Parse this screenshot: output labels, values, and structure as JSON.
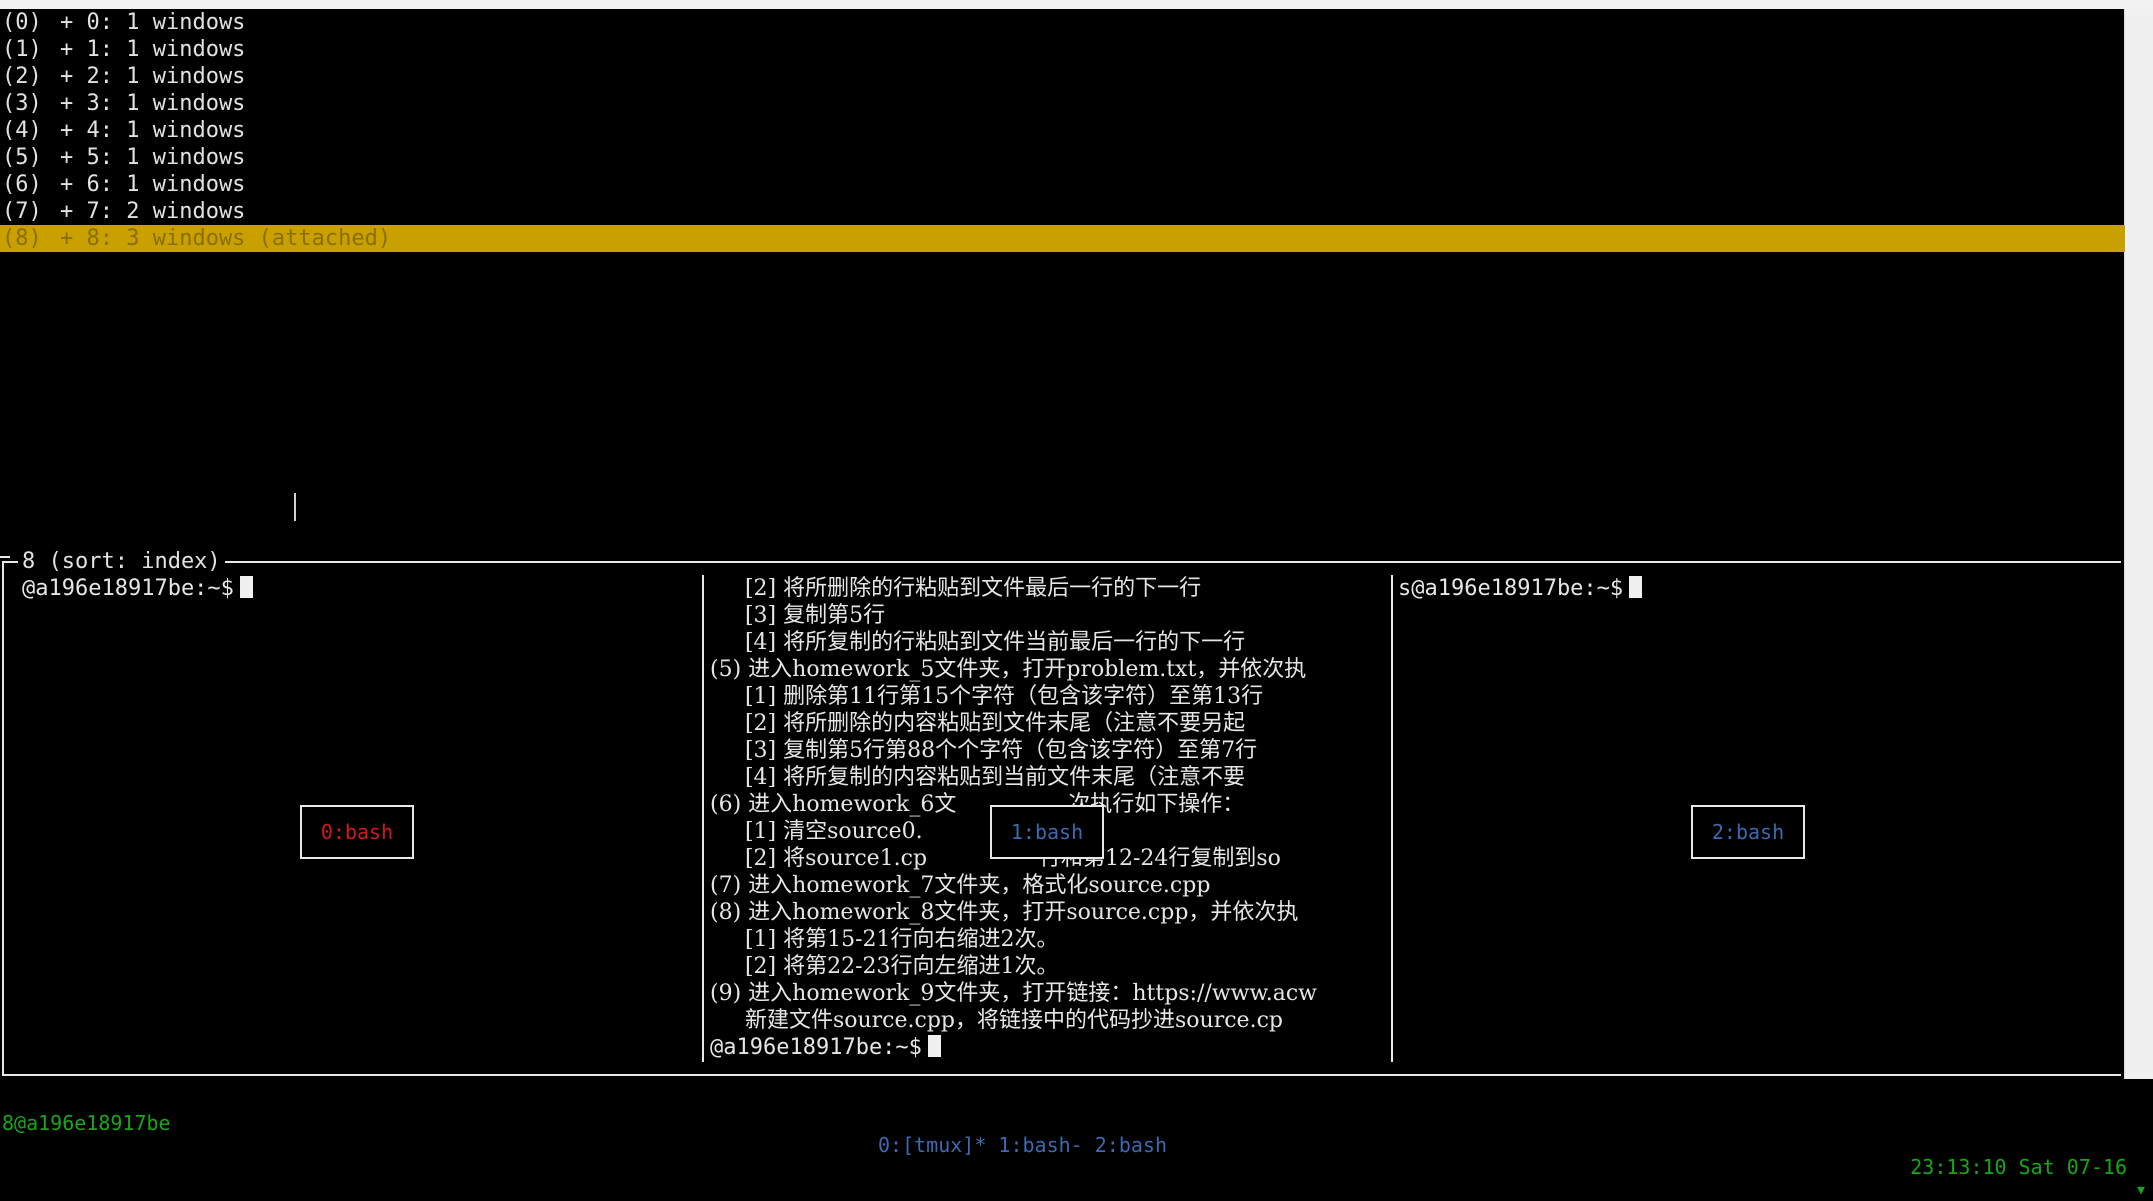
{
  "sessions": [
    {
      "index": "(0)",
      "label": "+ 0: 1 windows"
    },
    {
      "index": "(1)",
      "label": "+ 1: 1 windows"
    },
    {
      "index": "(2)",
      "label": "+ 2: 1 windows"
    },
    {
      "index": "(3)",
      "label": "+ 3: 1 windows"
    },
    {
      "index": "(4)",
      "label": "+ 4: 1 windows"
    },
    {
      "index": "(5)",
      "label": "+ 5: 1 windows"
    },
    {
      "index": "(6)",
      "label": "+ 6: 1 windows"
    },
    {
      "index": "(7)",
      "label": "+ 7: 2 windows"
    },
    {
      "index": "(8)",
      "label": "+ 8: 3 windows (attached)",
      "selected": true
    }
  ],
  "preview": {
    "title": "8 (sort: index)",
    "left_prompt": "@a196e18917be:~$",
    "right_prompt": "s@a196e18917be:~$",
    "middle_lines": [
      "     [2] 将所删除的行粘贴到文件最后一行的下一行",
      "     [3] 复制第5行",
      "     [4] 将所复制的行粘贴到文件当前最后一行的下一行",
      "(5) 进入homework_5文件夹，打开problem.txt，并依次执",
      "     [1] 删除第11行第15个字符（包含该字符）至第13行",
      "     [2] 将所删除的内容粘贴到文件末尾（注意不要另起",
      "     [3] 复制第5行第88个个字符（包含该字符）至第7行",
      "     [4] 将所复制的内容粘贴到当前文件末尾（注意不要",
      "(6) 进入homework_6文                次执行如下操作：",
      "     [1] 清空source0.",
      "     [2] 将source1.cp                行和第12-24行复制到so",
      "(7) 进入homework_7文件夹，格式化source.cpp",
      "(8) 进入homework_8文件夹，打开source.cpp，并依次执",
      "     [1] 将第15-21行向右缩进2次。",
      "     [2] 将第22-23行向左缩进1次。",
      "(9) 进入homework_9文件夹，打开链接：https://www.acw",
      "     新建文件source.cpp，将链接中的代码抄进source.cp"
    ],
    "middle_prompt": "@a196e18917be:~$",
    "window_labels": [
      {
        "text": "0:bash",
        "color": "#d21a1a"
      },
      {
        "text": "1:bash",
        "color": "#3c6ab0"
      },
      {
        "text": "2:bash",
        "color": "#3c6ab0"
      }
    ]
  },
  "status": {
    "left": "8@a196e18917be",
    "middle": "0:[tmux]* 1:bash- 2:bash",
    "right": "23:13:10 Sat 07-16",
    "arrow": "▾"
  },
  "colors": {
    "background": "#000000",
    "selection": "#c8a000",
    "status_green": "#17a617",
    "status_blue": "#3c6ab0"
  }
}
